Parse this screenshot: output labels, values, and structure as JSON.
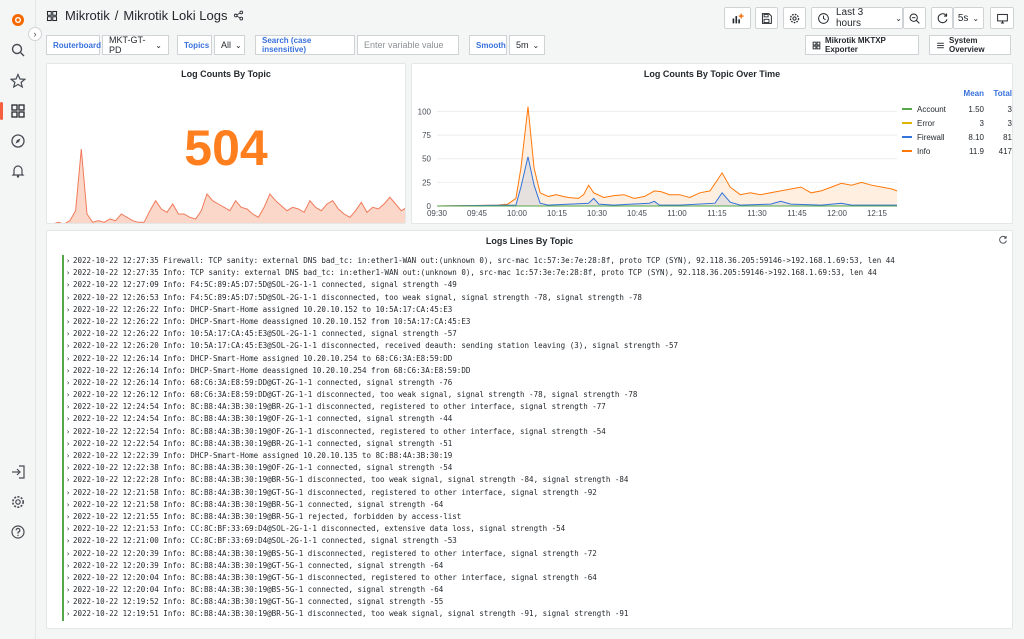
{
  "topbar": {
    "folder": "Mikrotik",
    "separator": "/",
    "dashboard_title": "Mikrotik Loki Logs",
    "time_range": "Last 3 hours",
    "refresh_interval": "5s"
  },
  "variables": [
    {
      "label": "Routerboard",
      "value": "MKT-GT-PD"
    },
    {
      "label": "Topics",
      "value": "All"
    },
    {
      "label": "Search (case insensitive)",
      "placeholder": "Enter variable value"
    },
    {
      "label": "Smooth",
      "value": "5m"
    }
  ],
  "links": {
    "exporter": "Mikrotik MKTXP Exporter",
    "overview": "System Overview"
  },
  "stat_panel": {
    "title": "Log Counts By Topic",
    "value": "504",
    "color": "#ff7f1f",
    "sparkline": [
      0,
      0,
      1,
      0,
      2,
      8,
      45,
      6,
      1,
      2,
      1,
      3,
      2,
      6,
      4,
      2,
      1,
      1,
      8,
      14,
      9,
      7,
      12,
      6,
      6,
      4,
      3,
      8,
      18,
      14,
      12,
      10,
      8,
      14,
      10,
      9,
      6,
      4,
      10,
      18,
      14,
      11,
      8,
      10,
      9,
      7,
      14,
      10,
      8,
      12,
      14,
      9,
      6,
      4,
      8,
      13,
      7,
      10,
      9,
      12,
      16,
      12,
      8,
      10
    ]
  },
  "timeseries_panel": {
    "title": "Log Counts By Topic Over Time",
    "legend": {
      "mean_header": "Mean",
      "total_header": "Total",
      "rows": [
        {
          "name": "Account",
          "mean": "1.50",
          "total": "3",
          "color": "#56a64b"
        },
        {
          "name": "Error",
          "mean": "3",
          "total": "3",
          "color": "#e0b400"
        },
        {
          "name": "Firewall",
          "mean": "8.10",
          "total": "81",
          "color": "#3274d9"
        },
        {
          "name": "Info",
          "mean": "11.9",
          "total": "417",
          "color": "#ff780a"
        }
      ]
    }
  },
  "chart_data": {
    "type": "area",
    "title": "Log Counts By Topic Over Time",
    "y_ticks": [
      "100",
      "75",
      "50",
      "25",
      "0"
    ],
    "ylim": [
      0,
      110
    ],
    "x_ticks": [
      "09:30",
      "09:45",
      "10:00",
      "10:15",
      "10:30",
      "10:45",
      "11:00",
      "11:15",
      "11:30",
      "11:45",
      "12:00",
      "12:15"
    ],
    "series": [
      {
        "name": "Info",
        "color": "#ff780a",
        "points": [
          [
            0,
            0
          ],
          [
            60,
            1
          ],
          [
            70,
            2
          ],
          [
            78,
            8
          ],
          [
            83,
            40
          ],
          [
            90,
            105
          ],
          [
            96,
            40
          ],
          [
            102,
            14
          ],
          [
            110,
            10
          ],
          [
            118,
            12
          ],
          [
            125,
            10
          ],
          [
            130,
            9
          ],
          [
            140,
            8
          ],
          [
            145,
            12
          ],
          [
            150,
            22
          ],
          [
            155,
            14
          ],
          [
            165,
            9
          ],
          [
            175,
            11
          ],
          [
            185,
            12
          ],
          [
            195,
            8
          ],
          [
            205,
            10
          ],
          [
            215,
            16
          ],
          [
            222,
            15
          ],
          [
            230,
            12
          ],
          [
            240,
            12
          ],
          [
            250,
            9
          ],
          [
            260,
            14
          ],
          [
            270,
            16
          ],
          [
            282,
            35
          ],
          [
            290,
            20
          ],
          [
            300,
            12
          ],
          [
            310,
            14
          ],
          [
            320,
            12
          ],
          [
            330,
            14
          ],
          [
            340,
            16
          ],
          [
            350,
            18
          ],
          [
            360,
            20
          ],
          [
            370,
            14
          ],
          [
            380,
            16
          ],
          [
            390,
            20
          ],
          [
            400,
            24
          ],
          [
            410,
            22
          ],
          [
            420,
            25
          ],
          [
            430,
            22
          ],
          [
            440,
            20
          ],
          [
            450,
            18
          ],
          [
            455,
            16
          ]
        ]
      },
      {
        "name": "Firewall",
        "color": "#3274d9",
        "points": [
          [
            0,
            0
          ],
          [
            78,
            1
          ],
          [
            83,
            20
          ],
          [
            90,
            52
          ],
          [
            96,
            22
          ],
          [
            102,
            3
          ],
          [
            110,
            1
          ],
          [
            150,
            3
          ],
          [
            155,
            8
          ],
          [
            160,
            2
          ],
          [
            175,
            1
          ],
          [
            210,
            3
          ],
          [
            215,
            5
          ],
          [
            220,
            1
          ],
          [
            240,
            1
          ],
          [
            275,
            3
          ],
          [
            282,
            14
          ],
          [
            290,
            4
          ],
          [
            300,
            1
          ],
          [
            330,
            2
          ],
          [
            340,
            5
          ],
          [
            350,
            2
          ],
          [
            380,
            1
          ],
          [
            400,
            3
          ],
          [
            410,
            1
          ],
          [
            455,
            1
          ]
        ]
      },
      {
        "name": "Error",
        "color": "#e0b400",
        "points": [
          [
            0,
            0
          ],
          [
            455,
            0
          ]
        ]
      },
      {
        "name": "Account",
        "color": "#56a64b",
        "points": [
          [
            0,
            0
          ],
          [
            455,
            0
          ]
        ]
      }
    ]
  },
  "logs_panel": {
    "title": "Logs Lines By Topic",
    "lines": [
      "2022-10-22 12:27:35 Firewall: TCP sanity: external DNS bad_tc: in:ether1-WAN out:(unknown 0), src-mac 1c:57:3e:7e:28:8f, proto TCP (SYN), 92.118.36.205:59146->192.168.1.69:53, len 44",
      "2022-10-22 12:27:35 Info: TCP sanity: external DNS bad_tc: in:ether1-WAN out:(unknown 0), src-mac 1c:57:3e:7e:28:8f, proto TCP (SYN), 92.118.36.205:59146->192.168.1.69:53, len 44",
      "2022-10-22 12:27:09 Info: F4:5C:89:A5:D7:5D@SOL-2G-1-1 connected, signal strength -49",
      "2022-10-22 12:26:53 Info: F4:5C:89:A5:D7:5D@SOL-2G-1-1 disconnected, too weak signal, signal strength -78, signal strength -78",
      "2022-10-22 12:26:22 Info: DHCP-Smart-Home assigned 10.20.10.152 to 10:5A:17:CA:45:E3",
      "2022-10-22 12:26:22 Info: DHCP-Smart-Home deassigned 10.20.10.152 from 10:5A:17:CA:45:E3",
      "2022-10-22 12:26:22 Info: 10:5A:17:CA:45:E3@SOL-2G-1-1 connected, signal strength -57",
      "2022-10-22 12:26:20 Info: 10:5A:17:CA:45:E3@SOL-2G-1-1 disconnected, received deauth: sending station leaving (3), signal strength -57",
      "2022-10-22 12:26:14 Info: DHCP-Smart-Home assigned 10.20.10.254 to 68:C6:3A:E8:59:DD",
      "2022-10-22 12:26:14 Info: DHCP-Smart-Home deassigned 10.20.10.254 from 68:C6:3A:E8:59:DD",
      "2022-10-22 12:26:14 Info: 68:C6:3A:E8:59:DD@GT-2G-1-1 connected, signal strength -76",
      "2022-10-22 12:26:12 Info: 68:C6:3A:E8:59:DD@GT-2G-1-1 disconnected, too weak signal, signal strength -78, signal strength -78",
      "2022-10-22 12:24:54 Info: 8C:B8:4A:3B:30:19@BR-2G-1-1 disconnected, registered to other interface, signal strength -77",
      "2022-10-22 12:24:54 Info: 8C:B8:4A:3B:30:19@OF-2G-1-1 connected, signal strength -44",
      "2022-10-22 12:22:54 Info: 8C:B8:4A:3B:30:19@OF-2G-1-1 disconnected, registered to other interface, signal strength -54",
      "2022-10-22 12:22:54 Info: 8C:B8:4A:3B:30:19@BR-2G-1-1 connected, signal strength -51",
      "2022-10-22 12:22:39 Info: DHCP-Smart-Home assigned 10.20.10.135 to 8C:B8:4A:3B:30:19",
      "2022-10-22 12:22:38 Info: 8C:B8:4A:3B:30:19@OF-2G-1-1 connected, signal strength -54",
      "2022-10-22 12:22:28 Info: 8C:B8:4A:3B:30:19@BR-5G-1 disconnected, too weak signal, signal strength -84, signal strength -84",
      "2022-10-22 12:21:58 Info: 8C:B8:4A:3B:30:19@GT-5G-1 disconnected, registered to other interface, signal strength -92",
      "2022-10-22 12:21:58 Info: 8C:B8:4A:3B:30:19@BR-5G-1 connected, signal strength -64",
      "2022-10-22 12:21:55 Info: 8C:B8:4A:3B:30:19@BR-5G-1 rejected, forbidden by access-list",
      "2022-10-22 12:21:53 Info: CC:8C:BF:33:69:D4@SOL-2G-1-1 disconnected, extensive data loss, signal strength -54",
      "2022-10-22 12:21:00 Info: CC:8C:BF:33:69:D4@SOL-2G-1-1 connected, signal strength -53",
      "2022-10-22 12:20:39 Info: 8C:B8:4A:3B:30:19@BS-5G-1 disconnected, registered to other interface, signal strength -72",
      "2022-10-22 12:20:39 Info: 8C:B8:4A:3B:30:19@GT-5G-1 connected, signal strength -64",
      "2022-10-22 12:20:04 Info: 8C:B8:4A:3B:30:19@GT-5G-1 disconnected, registered to other interface, signal strength -64",
      "2022-10-22 12:20:04 Info: 8C:B8:4A:3B:30:19@BS-5G-1 connected, signal strength -64",
      "2022-10-22 12:19:52 Info: 8C:B8:4A:3B:30:19@GT-5G-1 connected, signal strength -55",
      "2022-10-22 12:19:51 Info: 8C:B8:4A:3B:30:19@BR-5G-1 disconnected, too weak signal, signal strength -91, signal strength -91"
    ]
  }
}
